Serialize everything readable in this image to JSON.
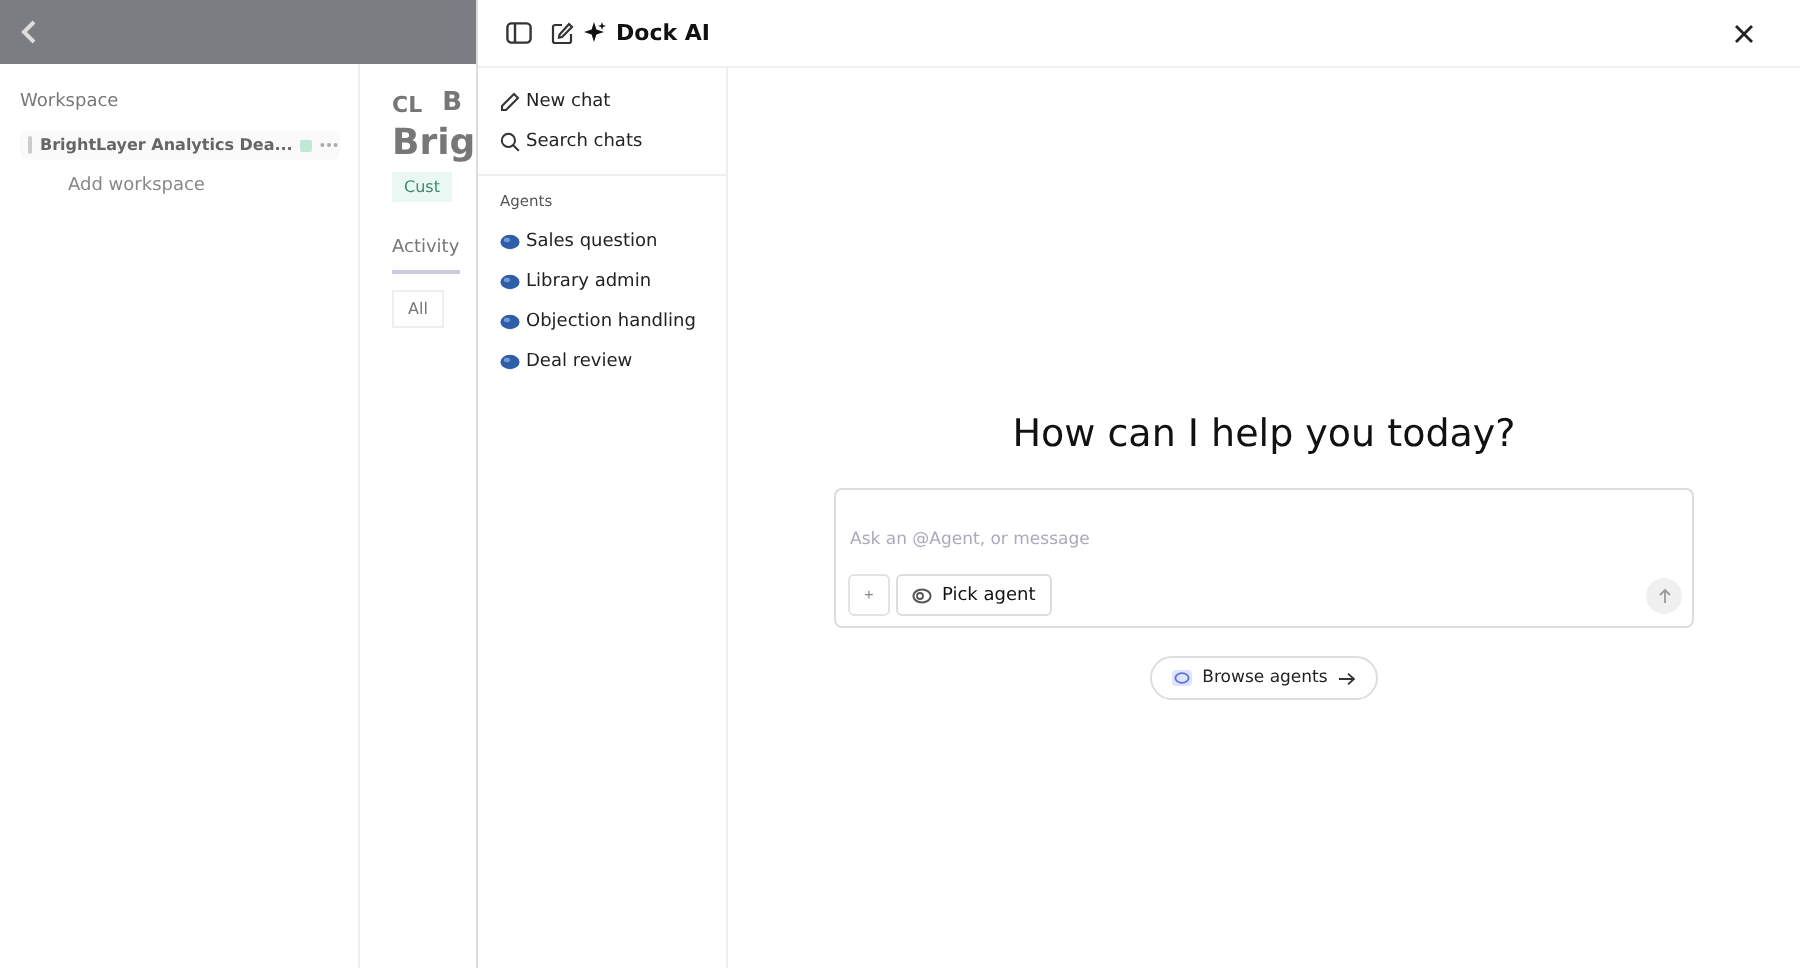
{
  "background_page": {
    "sidebar_heading": "Workspace",
    "workspace_item": "BrightLayer Analytics Dea...",
    "add_workspace": "Add workspace",
    "avatar_initials": "CL",
    "title_initial": "B",
    "title": "Brig",
    "tag": "Cust",
    "tab": "Activity",
    "filter": "All"
  },
  "panel": {
    "title": "Dock AI",
    "menu": [
      {
        "label": "New chat",
        "kind": "new"
      },
      {
        "label": "Search chats",
        "kind": "search"
      }
    ],
    "agents_heading": "Agents",
    "agents": [
      {
        "label": "Sales question"
      },
      {
        "label": "Library admin"
      },
      {
        "label": "Objection handling"
      },
      {
        "label": "Deal review"
      }
    ],
    "greeting": "How can I help you today?",
    "composer": {
      "placeholder": "Ask an @Agent, or message",
      "add_button": "+",
      "pick_button": "Pick agent"
    },
    "browse_button": "Browse agents"
  }
}
